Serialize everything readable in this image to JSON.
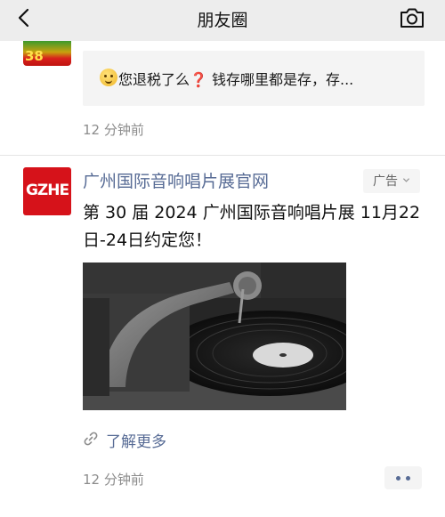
{
  "nav": {
    "title": "朋友圈"
  },
  "previous_post": {
    "avatar_number": "38",
    "shared_text": "您退税了么❓ 钱存哪里都是存，存...",
    "time": "12 分钟前"
  },
  "ad_post": {
    "avatar_text": "GZHE",
    "name": "广州国际音响唱片展官网",
    "badge": "广告",
    "text": "第 30 届 2024 广州国际音响唱片展 11月22日-24日约定您！",
    "learn_more": "了解更多",
    "time": "12 分钟前"
  },
  "colors": {
    "link": "#576b95",
    "nav_bg": "#ededed",
    "brand_red": "#d6121a"
  }
}
